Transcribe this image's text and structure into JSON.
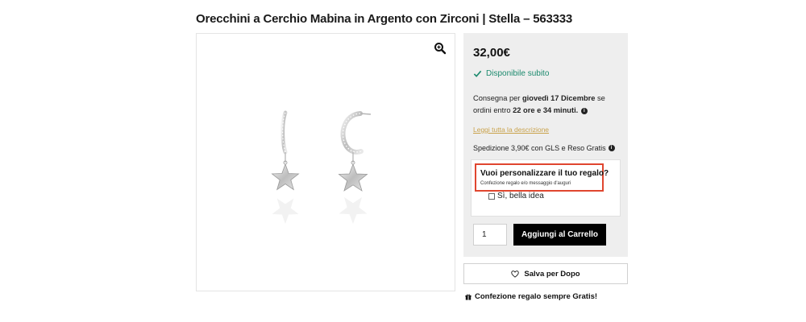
{
  "product": {
    "title": "Orecchini a Cerchio Mabina in Argento con Zirconi | Stella – 563333"
  },
  "gallery": {
    "zoom_icon": "zoom-in-icon",
    "image": "silver-star-hoop-earrings"
  },
  "buy_box": {
    "price": "32,00€",
    "availability": "Disponibile subito",
    "delivery": {
      "prefix": "Consegna per ",
      "date": "giovedì 17 Dicembre",
      "middle": " se ordini entro ",
      "countdown": "22 ore e 34 minuti.",
      "info_icon": "info-icon"
    },
    "read_more": "Leggi tutta la descrizione",
    "shipping": "Spedizione 3,90€ con GLS e Reso Gratis",
    "gift": {
      "question": "Vuoi personalizzare il tuo regalo?",
      "sub": "Confezione regalo e/o messaggio d'auguri",
      "checkbox_label": "Sì, bella idea"
    },
    "quantity": "1",
    "add_to_cart": "Aggiungi al Carrello"
  },
  "save_later": "Salva per Dopo",
  "gift_free": "Confezione regalo sempre Gratis!",
  "colors": {
    "availability": "#1c8a6e",
    "link": "#c9a24b",
    "highlight": "#e0462f",
    "button": "#000000",
    "panel": "#eeeeee"
  }
}
